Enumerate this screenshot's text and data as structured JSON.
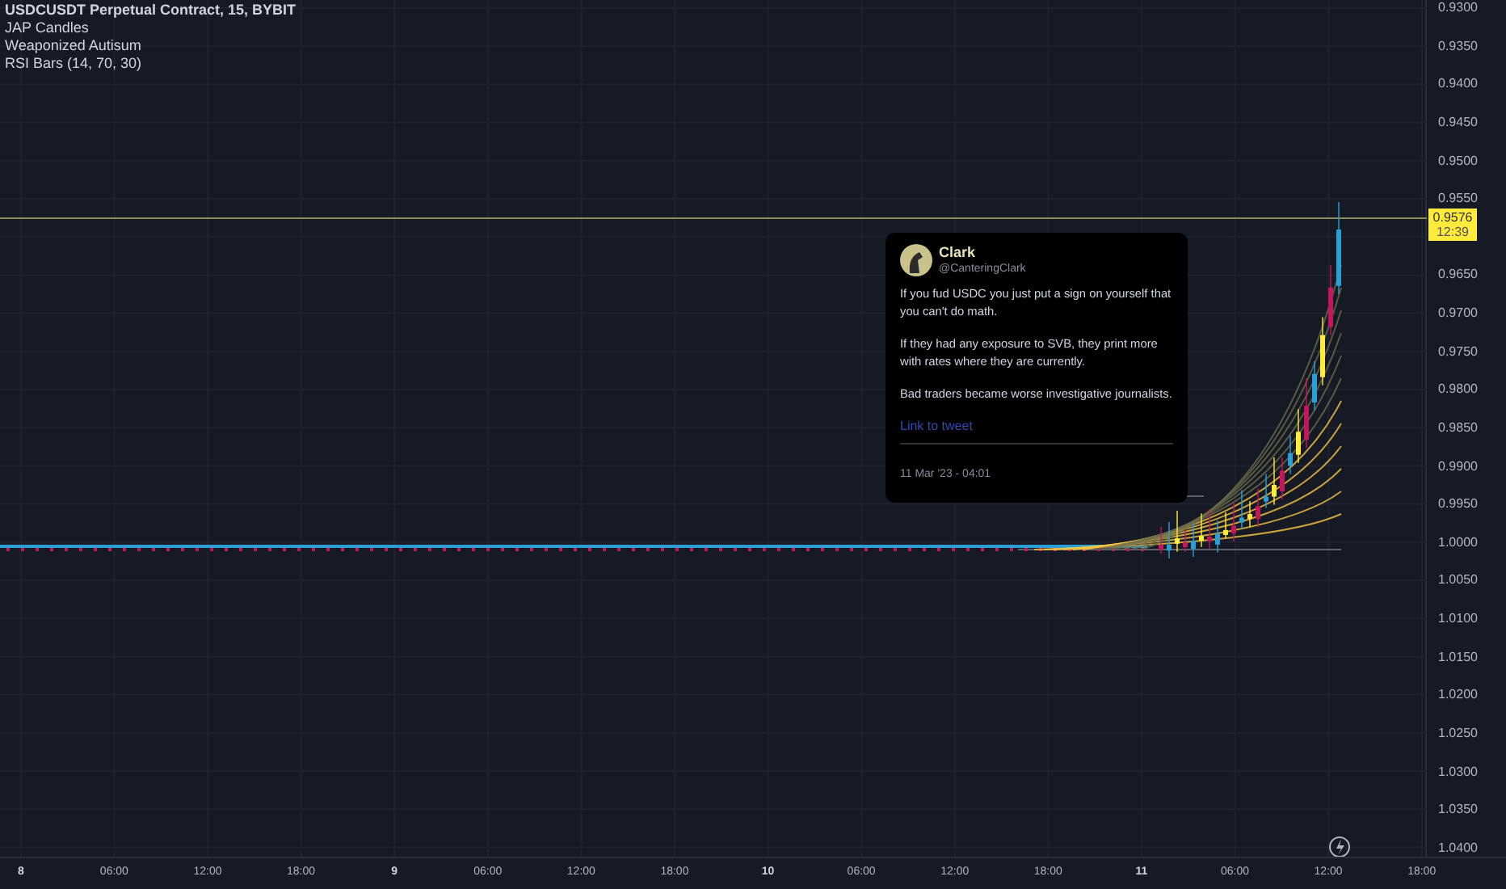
{
  "legend": {
    "title": "USDCUSDT Perpetual Contract, 15, BYBIT",
    "indicators": [
      "JAP Candles",
      "Weaponized Autisum",
      "RSI Bars (14, 70, 30)"
    ]
  },
  "price_axis": [
    "0.9300",
    "0.9350",
    "0.9400",
    "0.9450",
    "0.9500",
    "0.9550",
    "0.9650",
    "0.9700",
    "0.9750",
    "0.9800",
    "0.9850",
    "0.9900",
    "0.9950",
    "1.0000",
    "1.0050",
    "1.0100",
    "1.0150",
    "1.0200",
    "1.0250",
    "1.0300",
    "1.0350",
    "1.0400"
  ],
  "current_price": {
    "value": "0.9576",
    "countdown": "12:39"
  },
  "time_axis": [
    {
      "label": "8",
      "kind": "day"
    },
    {
      "label": "06:00",
      "kind": "time"
    },
    {
      "label": "12:00",
      "kind": "time"
    },
    {
      "label": "18:00",
      "kind": "time"
    },
    {
      "label": "9",
      "kind": "day"
    },
    {
      "label": "06:00",
      "kind": "time"
    },
    {
      "label": "12:00",
      "kind": "time"
    },
    {
      "label": "18:00",
      "kind": "time"
    },
    {
      "label": "10",
      "kind": "day"
    },
    {
      "label": "06:00",
      "kind": "time"
    },
    {
      "label": "12:00",
      "kind": "time"
    },
    {
      "label": "18:00",
      "kind": "time"
    },
    {
      "label": "11",
      "kind": "day"
    },
    {
      "label": "06:00",
      "kind": "time"
    },
    {
      "label": "12:00",
      "kind": "time"
    },
    {
      "label": "18:00",
      "kind": "time"
    }
  ],
  "tweet": {
    "name": "Clark",
    "handle": "@CanteringClark",
    "paragraphs": [
      "If you fud USDC you just put a sign on yourself that you can't do math.",
      "If they had any exposure to SVB, they print more with rates where they are currently.",
      "Bad traders became worse investigative journalists."
    ],
    "link": "Link to tweet",
    "date": "11 Mar '23 - 04:01"
  }
}
